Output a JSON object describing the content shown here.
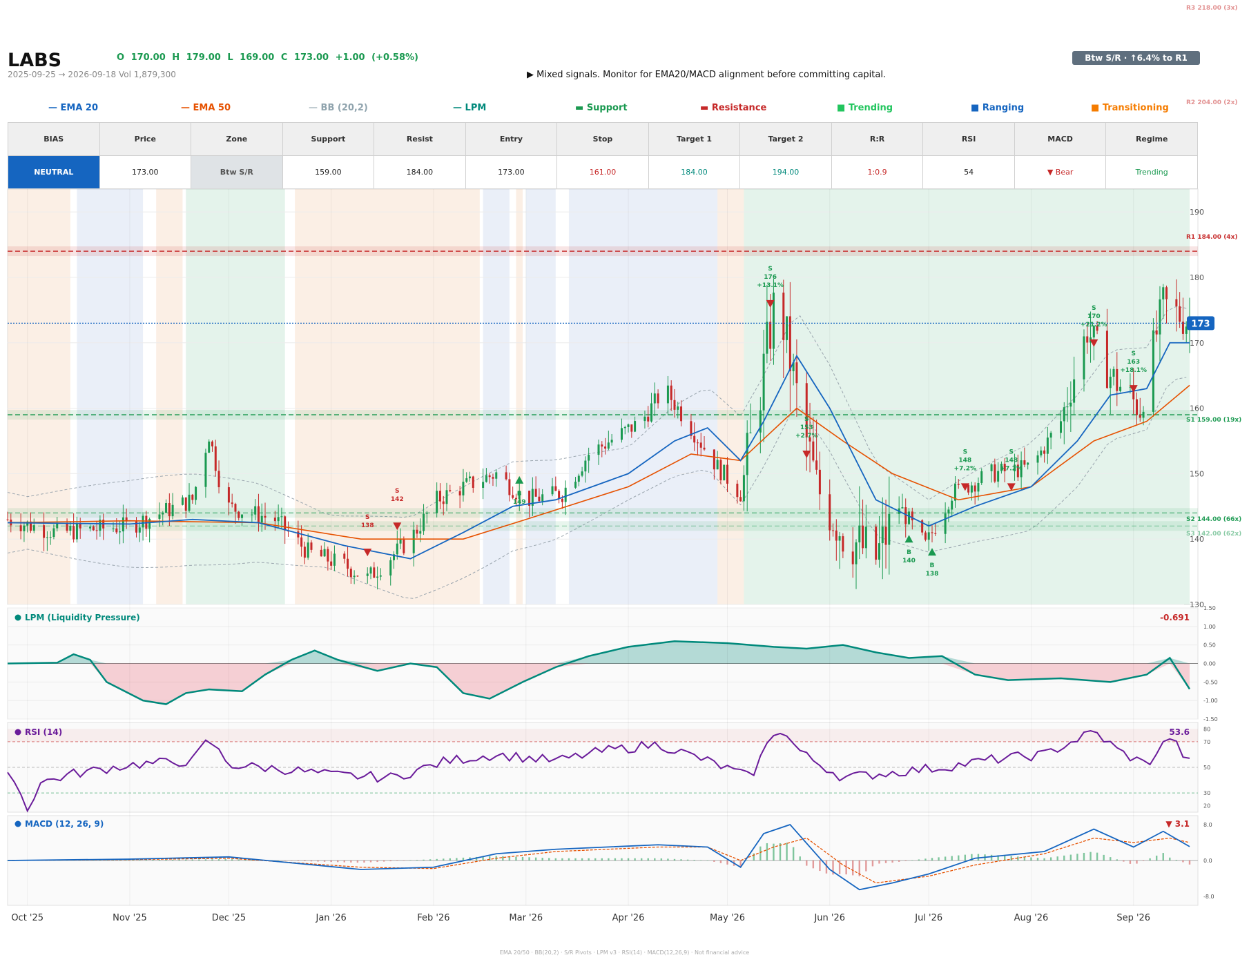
{
  "header": {
    "ticker": "LABS",
    "ohlc": "O 170.00   H 179.00   L 169.00   C 173.00   +1.00  (+0.58%)",
    "date_range": "2025-09-25 → 2026-09-18",
    "volume": "Vol 1,879,300",
    "advice": "▶  Mixed signals. Monitor for EMA20/MACD alignment before committing capital.",
    "zone_badge": "Btw S/R  ·  ↑6.4% to R1"
  },
  "legend": [
    {
      "symbol": "—",
      "label": "EMA 20",
      "color": "#1565c0"
    },
    {
      "symbol": "—",
      "label": "EMA 50",
      "color": "#e65100"
    },
    {
      "symbol": "—",
      "label": "BB (20,2)",
      "color": "#90a4ae"
    },
    {
      "symbol": "—",
      "label": "LPM",
      "color": "#00897b"
    },
    {
      "symbol": "▬",
      "label": "Support",
      "color": "#1a9950"
    },
    {
      "symbol": "▬",
      "label": "Resistance",
      "color": "#c62828"
    },
    {
      "symbol": "■",
      "label": "Trending",
      "color": "#22c55e"
    },
    {
      "symbol": "■",
      "label": "Ranging",
      "color": "#1565c0"
    },
    {
      "symbol": "■",
      "label": "Transitioning",
      "color": "#f57c00"
    }
  ],
  "summary": {
    "headers": [
      "BIAS",
      "Price",
      "Zone",
      "Support",
      "Resist",
      "Entry",
      "Stop",
      "Target 1",
      "Target 2",
      "R:R",
      "RSI",
      "MACD",
      "Regime"
    ],
    "values": [
      "NEUTRAL",
      "173.00",
      "Btw S/R",
      "159.00",
      "184.00",
      "173.00",
      "161.00",
      "184.00",
      "194.00",
      "1:0.9",
      "54",
      "▼ Bear",
      "Trending"
    ],
    "value_colors": [
      "#ffffff",
      "#222222",
      "#555555",
      "#222222",
      "#222222",
      "#222222",
      "#c62828",
      "#00897b",
      "#00897b",
      "#c62828",
      "#222222",
      "#c62828",
      "#1a9950"
    ]
  },
  "footer": "EMA 20/50  ·  BB(20,2)  ·  S/R Pivots  ·  LPM v3  ·  RSI(14)  ·  MACD(12,26,9)  ·  Not financial advice",
  "colors": {
    "up": "#1a9950",
    "down": "#c62828",
    "ema20": "#1565c0",
    "ema50": "#e65100",
    "bb": "#90a4ae",
    "lpm": "#00897b",
    "rsi": "#6a1b9a",
    "macd": "#1565c0",
    "signal": "#e65100",
    "trending": "#22c55e",
    "ranging": "#3f6fbf",
    "transitioning": "#f57c00"
  },
  "chart_data": [
    {
      "type": "candlestick",
      "title": "",
      "x_ticks": [
        "Oct '25",
        "Nov '25",
        "Dec '25",
        "Jan '26",
        "Feb '26",
        "Mar '26",
        "Apr '26",
        "May '26",
        "Jun '26",
        "Jul '26",
        "Aug '26",
        "Sep '26"
      ],
      "x_range": [
        "2025-09-25",
        "2026-09-18"
      ],
      "y_ticks": [
        130,
        140,
        150,
        160,
        170,
        180,
        190
      ],
      "ylim": [
        130,
        193.5
      ],
      "last_price": 173,
      "last_price_label": "173",
      "levels": [
        {
          "label": "R3 218.00 (3x)",
          "value": 218,
          "kind": "resistance"
        },
        {
          "label": "R2 204.00 (2x)",
          "value": 204,
          "kind": "resistance"
        },
        {
          "label": "R1 184.00 (4x)",
          "value": 184,
          "kind": "resistance"
        },
        {
          "label": "S1 159.00 (19x)",
          "value": 159,
          "kind": "support"
        },
        {
          "label": "S2 144.00 (66x)",
          "value": 144,
          "kind": "support"
        },
        {
          "label": "S3 142.00 (62x)",
          "value": 142,
          "kind": "support"
        }
      ],
      "regimes": [
        {
          "start": "2025-09-25",
          "end": "2025-10-14",
          "regime": "transitioning"
        },
        {
          "start": "2025-10-16",
          "end": "2025-11-05",
          "regime": "ranging"
        },
        {
          "start": "2025-11-09",
          "end": "2025-11-17",
          "regime": "transitioning"
        },
        {
          "start": "2025-11-18",
          "end": "2025-12-18",
          "regime": "trending"
        },
        {
          "start": "2025-12-21",
          "end": "2026-02-15",
          "regime": "transitioning"
        },
        {
          "start": "2026-02-16",
          "end": "2026-02-24",
          "regime": "ranging"
        },
        {
          "start": "2026-02-26",
          "end": "2026-02-28",
          "regime": "transitioning"
        },
        {
          "start": "2026-03-01",
          "end": "2026-03-10",
          "regime": "ranging"
        },
        {
          "start": "2026-03-14",
          "end": "2026-04-28",
          "regime": "ranging"
        },
        {
          "start": "2026-04-28",
          "end": "2026-05-06",
          "regime": "transitioning"
        },
        {
          "start": "2026-05-06",
          "end": "2026-09-18",
          "regime": "trending"
        }
      ],
      "candle_anchors": [
        [
          "2025-09-25",
          143
        ],
        [
          "2025-10-10",
          141
        ],
        [
          "2025-11-01",
          142
        ],
        [
          "2025-11-20",
          146
        ],
        [
          "2025-11-25",
          156
        ],
        [
          "2025-11-30",
          145
        ],
        [
          "2025-12-15",
          143
        ],
        [
          "2025-12-25",
          138
        ],
        [
          "2026-01-05",
          136
        ],
        [
          "2026-01-12",
          134
        ],
        [
          "2026-01-25",
          140
        ],
        [
          "2026-02-02",
          146
        ],
        [
          "2026-02-10",
          148
        ],
        [
          "2026-02-20",
          150
        ],
        [
          "2026-03-01",
          146
        ],
        [
          "2026-03-12",
          147
        ],
        [
          "2026-03-20",
          153
        ],
        [
          "2026-04-05",
          158
        ],
        [
          "2026-04-12",
          163
        ],
        [
          "2026-04-20",
          157
        ],
        [
          "2026-04-28",
          151
        ],
        [
          "2026-05-05",
          147
        ],
        [
          "2026-05-10",
          160
        ],
        [
          "2026-05-16",
          178
        ],
        [
          "2026-05-22",
          162
        ],
        [
          "2026-05-28",
          148
        ],
        [
          "2026-06-05",
          141
        ],
        [
          "2026-06-15",
          137
        ],
        [
          "2026-06-22",
          145
        ],
        [
          "2026-06-30",
          139
        ],
        [
          "2026-07-08",
          147
        ],
        [
          "2026-07-20",
          150
        ],
        [
          "2026-08-01",
          151
        ],
        [
          "2026-08-10",
          158
        ],
        [
          "2026-08-18",
          172
        ],
        [
          "2026-08-25",
          165
        ],
        [
          "2026-09-03",
          160
        ],
        [
          "2026-09-10",
          176
        ],
        [
          "2026-09-18",
          173
        ]
      ],
      "ema20": [
        [
          "2025-09-25",
          142.5
        ],
        [
          "2025-11-01",
          142.3
        ],
        [
          "2025-11-20",
          143
        ],
        [
          "2025-12-10",
          142.5
        ],
        [
          "2026-01-05",
          139
        ],
        [
          "2026-01-25",
          137
        ],
        [
          "2026-02-10",
          141
        ],
        [
          "2026-02-25",
          145
        ],
        [
          "2026-03-10",
          146
        ],
        [
          "2026-04-01",
          150
        ],
        [
          "2026-04-15",
          155
        ],
        [
          "2026-04-25",
          157
        ],
        [
          "2026-05-05",
          152
        ],
        [
          "2026-05-12",
          158
        ],
        [
          "2026-05-22",
          168
        ],
        [
          "2026-06-01",
          160
        ],
        [
          "2026-06-15",
          146
        ],
        [
          "2026-07-01",
          142
        ],
        [
          "2026-07-15",
          145
        ],
        [
          "2026-08-01",
          148
        ],
        [
          "2026-08-15",
          155
        ],
        [
          "2026-08-25",
          162
        ],
        [
          "2026-09-05",
          163
        ],
        [
          "2026-09-12",
          170
        ],
        [
          "2026-09-18",
          170
        ]
      ],
      "ema50": [
        [
          "2025-09-25",
          142.5
        ],
        [
          "2025-11-01",
          142.8
        ],
        [
          "2025-12-10",
          142.5
        ],
        [
          "2026-01-10",
          140
        ],
        [
          "2026-02-10",
          140
        ],
        [
          "2026-03-01",
          143
        ],
        [
          "2026-04-01",
          148
        ],
        [
          "2026-04-20",
          153
        ],
        [
          "2026-05-05",
          152
        ],
        [
          "2026-05-22",
          160
        ],
        [
          "2026-06-05",
          155
        ],
        [
          "2026-06-20",
          150
        ],
        [
          "2026-07-10",
          146
        ],
        [
          "2026-08-01",
          148
        ],
        [
          "2026-08-20",
          155
        ],
        [
          "2026-09-05",
          158
        ],
        [
          "2026-09-18",
          163.5
        ]
      ],
      "signals": [
        {
          "date": "2026-01-21",
          "side": "S",
          "price": 142,
          "pct": ""
        },
        {
          "date": "2026-01-12",
          "side": "S",
          "price": 138,
          "pct": ""
        },
        {
          "date": "2026-02-27",
          "side": "B",
          "price": 149,
          "pct": ""
        },
        {
          "date": "2026-05-14",
          "side": "S",
          "price": 176,
          "pct": "+13.1%"
        },
        {
          "date": "2026-05-25",
          "side": "S",
          "price": 153,
          "pct": "+2.7%"
        },
        {
          "date": "2026-06-25",
          "side": "B",
          "price": 140,
          "pct": ""
        },
        {
          "date": "2026-07-02",
          "side": "B",
          "price": 138,
          "pct": ""
        },
        {
          "date": "2026-07-12",
          "side": "S",
          "price": 148,
          "pct": "+7.2%"
        },
        {
          "date": "2026-07-26",
          "side": "S",
          "price": 148,
          "pct": "+7.2%"
        },
        {
          "date": "2026-08-20",
          "side": "S",
          "price": 170,
          "pct": "+21.2%"
        },
        {
          "date": "2026-09-01",
          "side": "S",
          "price": 163,
          "pct": "+18.1%"
        }
      ]
    },
    {
      "type": "area",
      "title": "LPM (Liquidity Pressure)",
      "value_label": "-0.691",
      "y_ticks": [
        -1.5,
        -1.0,
        -0.5,
        0.0,
        0.5,
        1.0,
        1.5
      ],
      "ylim": [
        -1.5,
        1.5
      ],
      "points": [
        [
          "2025-09-25",
          0
        ],
        [
          "2025-10-10",
          0.02
        ],
        [
          "2025-10-15",
          0.25
        ],
        [
          "2025-10-20",
          0.1
        ],
        [
          "2025-10-25",
          -0.5
        ],
        [
          "2025-11-05",
          -1.0
        ],
        [
          "2025-11-12",
          -1.1
        ],
        [
          "2025-11-18",
          -0.8
        ],
        [
          "2025-11-25",
          -0.7
        ],
        [
          "2025-12-05",
          -0.75
        ],
        [
          "2025-12-12",
          -0.3
        ],
        [
          "2025-12-20",
          0.1
        ],
        [
          "2025-12-27",
          0.35
        ],
        [
          "2026-01-03",
          0.1
        ],
        [
          "2026-01-15",
          -0.2
        ],
        [
          "2026-01-25",
          0.0
        ],
        [
          "2026-02-02",
          -0.1
        ],
        [
          "2026-02-10",
          -0.8
        ],
        [
          "2026-02-18",
          -0.95
        ],
        [
          "2026-02-28",
          -0.5
        ],
        [
          "2026-03-10",
          -0.1
        ],
        [
          "2026-03-20",
          0.2
        ],
        [
          "2026-04-01",
          0.45
        ],
        [
          "2026-04-15",
          0.6
        ],
        [
          "2026-05-01",
          0.55
        ],
        [
          "2026-05-15",
          0.45
        ],
        [
          "2026-05-25",
          0.4
        ],
        [
          "2026-06-05",
          0.5
        ],
        [
          "2026-06-15",
          0.3
        ],
        [
          "2026-06-25",
          0.15
        ],
        [
          "2026-07-05",
          0.2
        ],
        [
          "2026-07-15",
          -0.3
        ],
        [
          "2026-07-25",
          -0.45
        ],
        [
          "2026-08-10",
          -0.4
        ],
        [
          "2026-08-25",
          -0.5
        ],
        [
          "2026-09-05",
          -0.3
        ],
        [
          "2026-09-12",
          0.15
        ],
        [
          "2026-09-18",
          -0.691
        ]
      ]
    },
    {
      "type": "line",
      "title": "RSI (14)",
      "value_label": "53.6",
      "y_ticks": [
        20,
        30,
        50,
        70,
        80
      ],
      "ylim": [
        15,
        85
      ],
      "points": [
        [
          "2025-09-25",
          50
        ],
        [
          "2025-10-01",
          18
        ],
        [
          "2025-10-05",
          38
        ],
        [
          "2025-10-15",
          45
        ],
        [
          "2025-11-01",
          52
        ],
        [
          "2025-11-20",
          55
        ],
        [
          "2025-11-25",
          72
        ],
        [
          "2025-12-01",
          52
        ],
        [
          "2025-12-20",
          48
        ],
        [
          "2026-01-01",
          44
        ],
        [
          "2026-01-20",
          42
        ],
        [
          "2026-02-05",
          55
        ],
        [
          "2026-02-20",
          60
        ],
        [
          "2026-03-10",
          55
        ],
        [
          "2026-03-25",
          63
        ],
        [
          "2026-04-10",
          68
        ],
        [
          "2026-04-25",
          55
        ],
        [
          "2026-05-08",
          42
        ],
        [
          "2026-05-16",
          82
        ],
        [
          "2026-05-24",
          60
        ],
        [
          "2026-06-05",
          42
        ],
        [
          "2026-06-20",
          46
        ],
        [
          "2026-07-05",
          50
        ],
        [
          "2026-07-20",
          56
        ],
        [
          "2026-08-05",
          60
        ],
        [
          "2026-08-20",
          78
        ],
        [
          "2026-08-28",
          62
        ],
        [
          "2026-09-05",
          52
        ],
        [
          "2026-09-12",
          74
        ],
        [
          "2026-09-18",
          53.6
        ]
      ]
    },
    {
      "type": "bar+line",
      "title": "MACD (12, 26, 9)",
      "value_label": "▼ 3.1",
      "y_ticks": [
        -8.0,
        0.0,
        8.0
      ],
      "ylim": [
        -10,
        10
      ],
      "macd": [
        [
          "2025-09-25",
          0
        ],
        [
          "2025-11-01",
          0.3
        ],
        [
          "2025-12-01",
          0.8
        ],
        [
          "2026-01-10",
          -2
        ],
        [
          "2026-02-01",
          -1.5
        ],
        [
          "2026-02-20",
          1.5
        ],
        [
          "2026-03-10",
          2.5
        ],
        [
          "2026-04-10",
          3.5
        ],
        [
          "2026-04-25",
          3.0
        ],
        [
          "2026-05-05",
          -1.5
        ],
        [
          "2026-05-12",
          6
        ],
        [
          "2026-05-20",
          8
        ],
        [
          "2026-06-01",
          -2
        ],
        [
          "2026-06-10",
          -6.5
        ],
        [
          "2026-06-20",
          -5
        ],
        [
          "2026-07-01",
          -3
        ],
        [
          "2026-07-15",
          0.5
        ],
        [
          "2026-08-05",
          2
        ],
        [
          "2026-08-20",
          7
        ],
        [
          "2026-09-01",
          3
        ],
        [
          "2026-09-10",
          6.5
        ],
        [
          "2026-09-18",
          3.1
        ]
      ],
      "signal": [
        [
          "2025-09-25",
          0
        ],
        [
          "2025-11-01",
          0.2
        ],
        [
          "2025-12-01",
          0.5
        ],
        [
          "2026-01-10",
          -1.5
        ],
        [
          "2026-02-01",
          -1.8
        ],
        [
          "2026-02-20",
          0.5
        ],
        [
          "2026-03-10",
          2
        ],
        [
          "2026-04-10",
          3
        ],
        [
          "2026-04-25",
          3
        ],
        [
          "2026-05-05",
          0
        ],
        [
          "2026-05-15",
          3
        ],
        [
          "2026-05-25",
          5
        ],
        [
          "2026-06-05",
          -1
        ],
        [
          "2026-06-15",
          -5
        ],
        [
          "2026-07-01",
          -3.5
        ],
        [
          "2026-07-15",
          -1
        ],
        [
          "2026-08-05",
          1.5
        ],
        [
          "2026-08-20",
          5
        ],
        [
          "2026-09-01",
          4
        ],
        [
          "2026-09-12",
          5
        ],
        [
          "2026-09-18",
          4
        ]
      ]
    }
  ]
}
